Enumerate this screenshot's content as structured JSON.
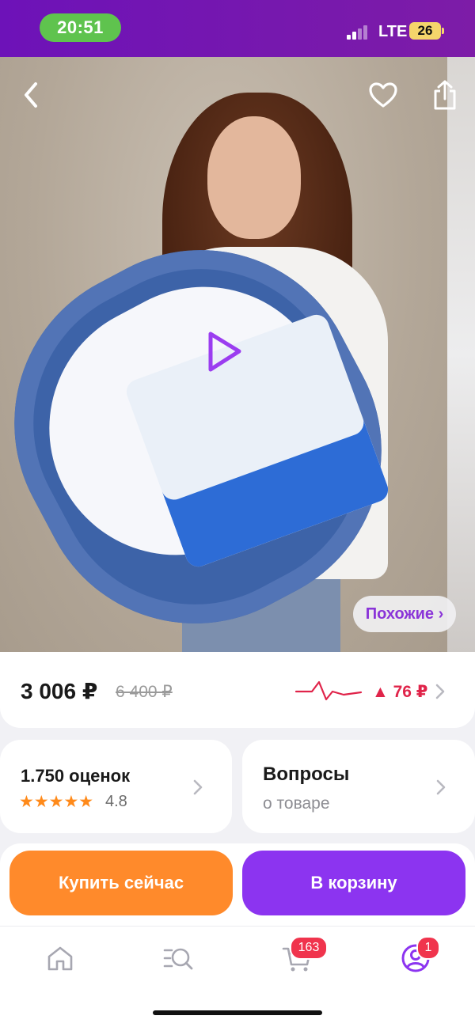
{
  "status_bar": {
    "time": "20:51",
    "network": "LTE",
    "battery": "26"
  },
  "product": {
    "similar_label": "Похожие ›",
    "price": "3 006 ₽",
    "old_price": "6 400 ₽",
    "price_change": "▲ 76 ₽"
  },
  "reviews": {
    "count_label": "1.750 оценок",
    "stars": "★★★★★",
    "rating": "4.8"
  },
  "questions": {
    "title": "Вопросы",
    "subtitle": "о товаре"
  },
  "actions": {
    "buy_now": "Купить сейчас",
    "add_to_cart": "В корзину"
  },
  "bottom_nav": {
    "cart_badge": "163",
    "profile_badge": "1"
  },
  "colors": {
    "accent_purple": "#8c34f0",
    "accent_orange": "#ff8a2b",
    "price_up": "#e0244a",
    "status_bar": "#7b1fa2"
  }
}
